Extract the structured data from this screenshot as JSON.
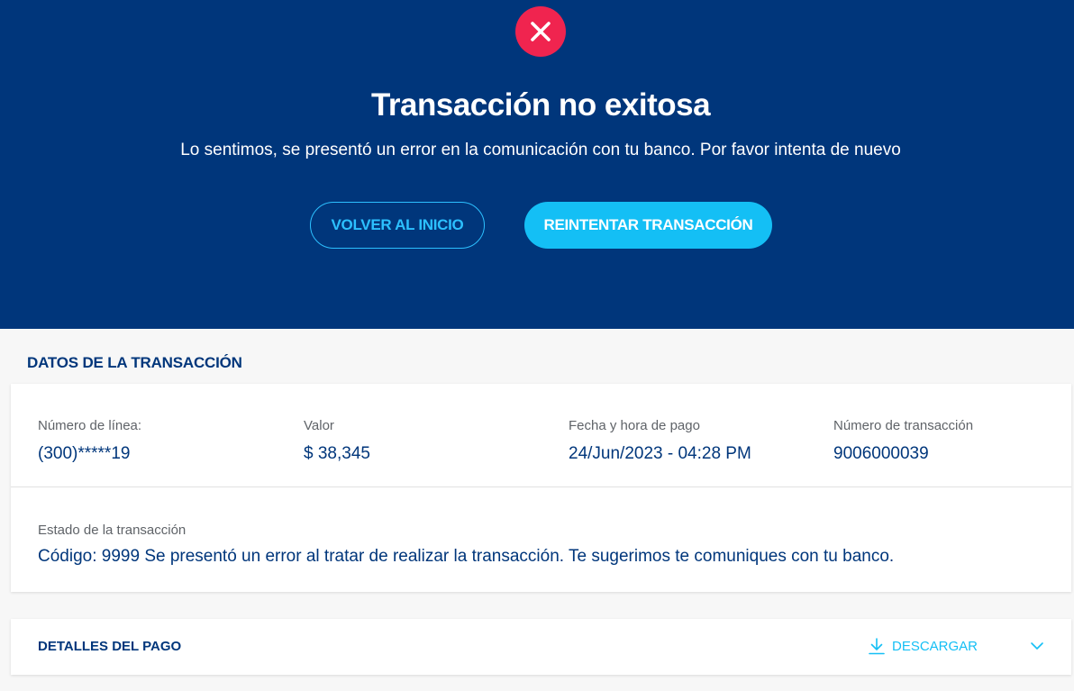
{
  "header": {
    "title": "Transacción no exitosa",
    "message": "Lo sentimos, se presentó un error en la comunicación con tu banco. Por favor intenta de nuevo",
    "back_button": "VOLVER AL INICIO",
    "retry_button": "REINTENTAR TRANSACCIÓN",
    "icon": "close-icon"
  },
  "transaction": {
    "section_title": "DATOS DE LA TRANSACCIÓN",
    "fields": [
      {
        "label": "Número de línea:",
        "value": "(300)*****19"
      },
      {
        "label": "Valor",
        "value": "$ 38,345"
      },
      {
        "label": "Fecha y hora de pago",
        "value": "24/Jun/2023 - 04:28 PM"
      },
      {
        "label": "Número de transacción",
        "value": "9006000039"
      }
    ],
    "status_label": "Estado de la transacción",
    "status_value": "Código: 9999 Se presentó un error al tratar de realizar la transacción. Te sugerimos te comuniques con tu banco."
  },
  "details": {
    "title": "DETALLES DEL PAGO",
    "download_label": "DESCARGAR",
    "download_icon": "download-icon",
    "expand_icon": "chevron-down-icon"
  },
  "colors": {
    "primary": "#00367b",
    "accent": "#14bff5",
    "error": "#f0244f"
  }
}
